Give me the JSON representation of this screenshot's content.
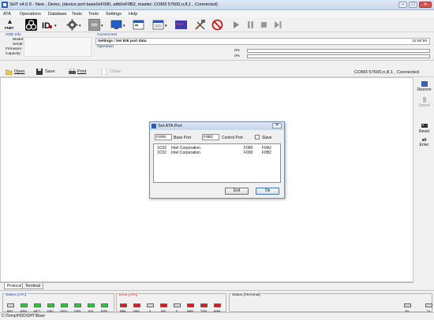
{
  "window": {
    "title": "SHT v4.0.9 - New , Demo,  (device port base0xF090, altb0xF0B2, master;   COM3  57600,n,8,1 ,  Connected)",
    "min": "–",
    "max": "□",
    "close": "✕"
  },
  "menu": [
    "ATA",
    "Operations",
    "Database",
    "Tests",
    "Tools",
    "Settings",
    "Help"
  ],
  "toolbar": {
    "icons": [
      "pnbt-icon",
      "biohazard-icon",
      "id-icon",
      "gear-icon",
      "drive-icon",
      "monitor-icon",
      "window-icon",
      "hex-icon",
      "tools-icon",
      "no-entry-icon",
      "play-icon",
      "pause-icon",
      "stop-icon",
      "skip-icon"
    ],
    "pnbt_label": "PNBT",
    "id_label": "ID",
    "hex_label": "HEX",
    "dropdown": "▾"
  },
  "hdd_info": {
    "header": "HDD Info",
    "model_label": "Model:",
    "serial_label": "Serial:",
    "firmware_label": "Firmware:",
    "capacity_label": "Capacity:"
  },
  "current_test": {
    "header": "Current test",
    "value": "Settings / Set IDE port data",
    "time": "22:50:59"
  },
  "operation": {
    "header": "Operation",
    "progress1": "0%",
    "progress2": "0%"
  },
  "filebar": {
    "open": "Open",
    "save": "Save",
    "print": "Print",
    "close": "Close",
    "connection": "COM3  57600,n,8,1 ,  Connected"
  },
  "rightbar": {
    "disconn": "Disconn",
    "speed": "Speed",
    "reset": "Reset",
    "enter": "Enter",
    "alt_label": "alt"
  },
  "tabs": [
    "Protocol",
    "Terminal"
  ],
  "status_ata": {
    "title": "Status [ATA]",
    "leds": [
      {
        "label": "BSY",
        "color": "#d8d8d8"
      },
      {
        "label": "DRD",
        "color": "#2ecc40"
      },
      {
        "label": "WFT",
        "color": "#2ecc40"
      },
      {
        "label": "DSC",
        "color": "#2ecc40"
      },
      {
        "label": "DRQ",
        "color": "#2ecc40"
      },
      {
        "label": "CRR",
        "color": "#2ecc40"
      },
      {
        "label": "IDX",
        "color": "#2ecc40"
      },
      {
        "label": "ERR",
        "color": "#2ecc40"
      }
    ]
  },
  "error_ata": {
    "title": "Error [ATA]",
    "leds": [
      {
        "label": "BBK",
        "color": "#d81e1e"
      },
      {
        "label": "UNC",
        "color": "#d81e1e"
      },
      {
        "label": "0",
        "color": "#d8d8d8"
      },
      {
        "label": "INF",
        "color": "#d81e1e"
      },
      {
        "label": "0",
        "color": "#d8d8d8"
      },
      {
        "label": "ABR",
        "color": "#d81e1e"
      },
      {
        "label": "TON",
        "color": "#d81e1e"
      },
      {
        "label": "AMN",
        "color": "#d81e1e"
      }
    ]
  },
  "status_terminal": {
    "title": "Status [Terminal]",
    "leds": [
      {
        "label": "Rx",
        "color": "#d8d8d8"
      },
      {
        "label": "Tx",
        "color": "#d8d8d8"
      }
    ]
  },
  "path": "C:\\Temp\\HDD\\SHT\\Base",
  "dialog": {
    "title": "Set ATA Port",
    "base_port_value": "F090",
    "base_port_label": "Base Port",
    "control_port_value": "F0B2",
    "control_port_label": "Control Port",
    "slave_label": "Slave",
    "rows": [
      {
        "id": "1C02",
        "vendor": "Intel Corporation",
        "base": "F080",
        "ctrl": "F0A2"
      },
      {
        "id": "1C02",
        "vendor": "Intel Corporation",
        "base": "F090",
        "ctrl": "F0B2"
      }
    ],
    "exit": "Exit",
    "ok": "Ok",
    "close": "✕"
  }
}
